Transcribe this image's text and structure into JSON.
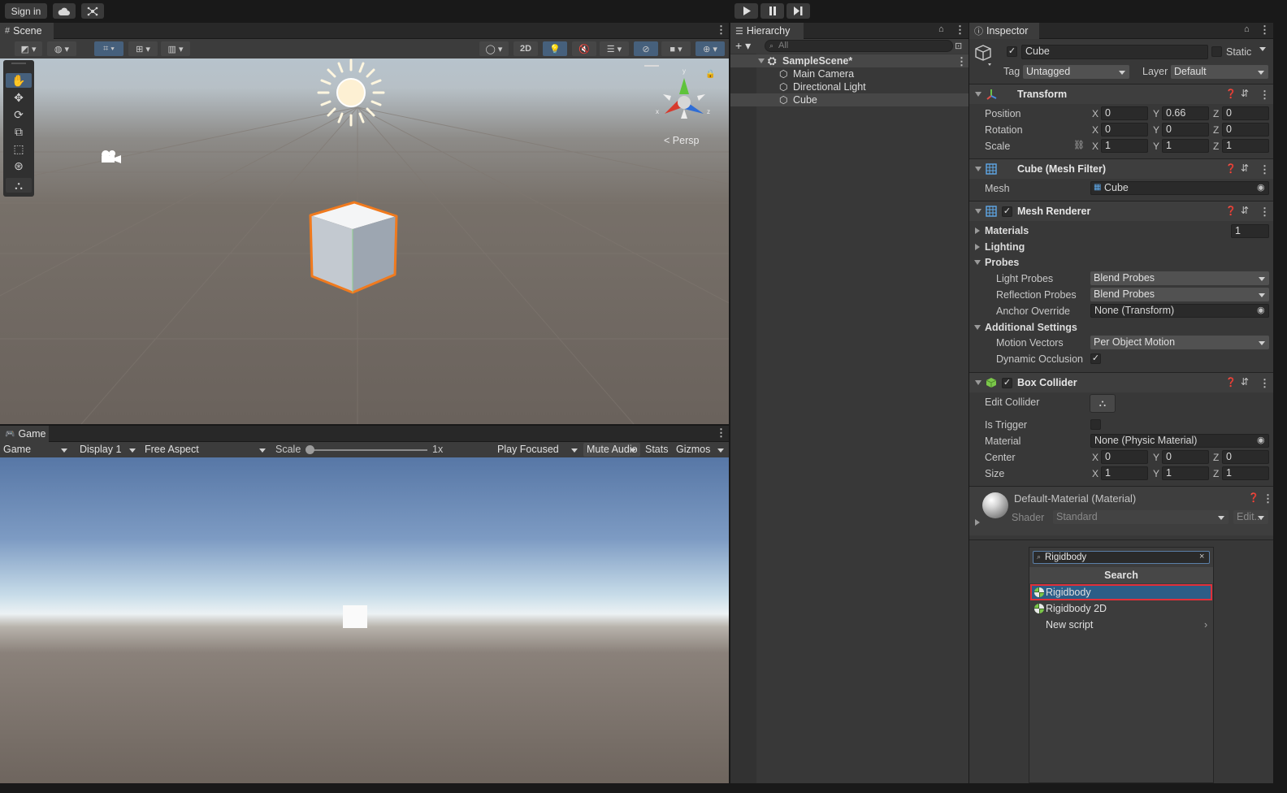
{
  "topbar": {
    "sign_in": "Sign in"
  },
  "scene": {
    "tab": "Scene",
    "toolbar": {
      "mode_2d": "2D"
    },
    "persp_label": "Persp",
    "gizmo_axes": {
      "x": "x",
      "y": "y",
      "z": "z"
    }
  },
  "game": {
    "tab": "Game",
    "toolbar": {
      "view": "Game",
      "display": "Display 1",
      "aspect": "Free Aspect",
      "scale_label": "Scale",
      "scale_value": "1x",
      "play_mode": "Play Focused",
      "mute": "Mute Audio",
      "stats": "Stats",
      "gizmos": "Gizmos"
    }
  },
  "hierarchy": {
    "tab": "Hierarchy",
    "search_placeholder": "All",
    "scene_name": "SampleScene*",
    "items": [
      "Main Camera",
      "Directional Light",
      "Cube"
    ]
  },
  "inspector": {
    "tab": "Inspector",
    "object_name": "Cube",
    "static_label": "Static",
    "tag_label": "Tag",
    "tag_value": "Untagged",
    "layer_label": "Layer",
    "layer_value": "Default",
    "transform": {
      "title": "Transform",
      "position_label": "Position",
      "position": [
        "0",
        "0.66",
        "0"
      ],
      "rotation_label": "Rotation",
      "rotation": [
        "0",
        "0",
        "0"
      ],
      "scale_label": "Scale",
      "scale": [
        "1",
        "1",
        "1"
      ]
    },
    "axis": {
      "x": "X",
      "y": "Y",
      "z": "Z"
    },
    "mesh_filter": {
      "title": "Cube (Mesh Filter)",
      "mesh_label": "Mesh",
      "mesh_value": "Cube"
    },
    "mesh_renderer": {
      "title": "Mesh Renderer",
      "materials_label": "Materials",
      "materials_count": "1",
      "lighting_label": "Lighting",
      "probes_label": "Probes",
      "light_probes_label": "Light Probes",
      "light_probes_value": "Blend Probes",
      "reflection_probes_label": "Reflection Probes",
      "reflection_probes_value": "Blend Probes",
      "anchor_override_label": "Anchor Override",
      "anchor_override_value": "None (Transform)",
      "additional_label": "Additional Settings",
      "motion_vectors_label": "Motion Vectors",
      "motion_vectors_value": "Per Object Motion",
      "dynamic_occlusion_label": "Dynamic Occlusion"
    },
    "box_collider": {
      "title": "Box Collider",
      "edit_collider_label": "Edit Collider",
      "is_trigger_label": "Is Trigger",
      "material_label": "Material",
      "material_value": "None (Physic Material)",
      "center_label": "Center",
      "center": [
        "0",
        "0",
        "0"
      ],
      "size_label": "Size",
      "size": [
        "1",
        "1",
        "1"
      ]
    },
    "material": {
      "title": "Default-Material (Material)",
      "shader_label": "Shader",
      "shader_value": "Standard",
      "edit_label": "Edit..."
    }
  },
  "add_component_popup": {
    "search_value": "Rigidbody",
    "header": "Search",
    "items": [
      "Rigidbody",
      "Rigidbody 2D",
      "New script"
    ]
  },
  "colors": {
    "selection": "#2c5d87",
    "highlight_border": "#e0303a",
    "cube_outline": "#f07a1e"
  }
}
